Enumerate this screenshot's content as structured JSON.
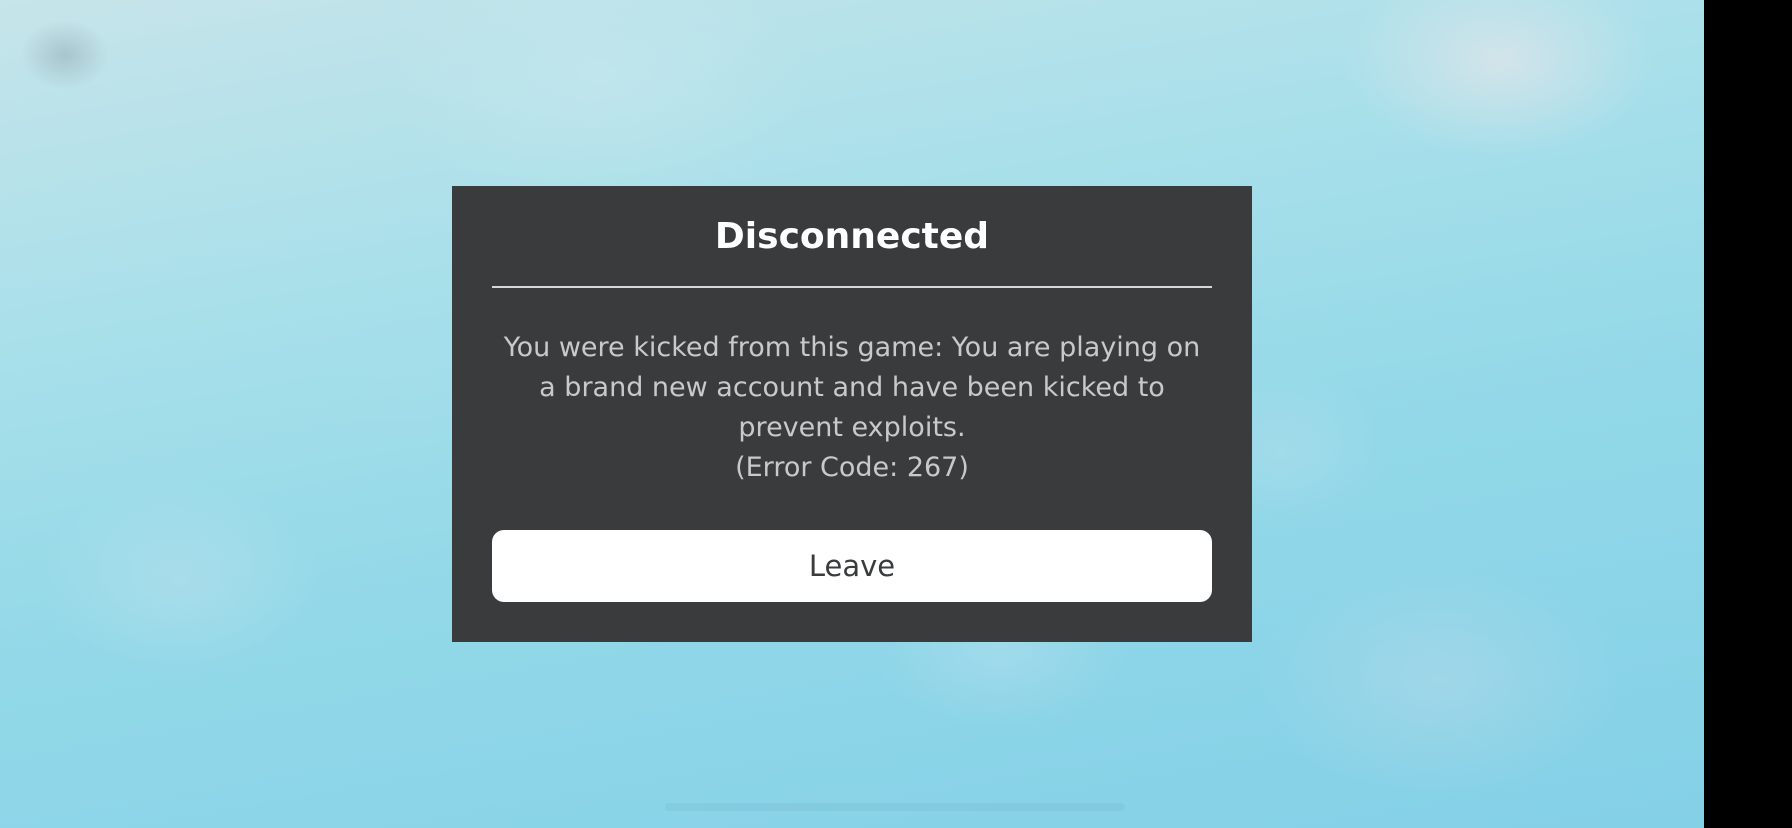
{
  "dialog": {
    "title": "Disconnected",
    "message": "You were kicked from this game: You are playing on a brand new account and have been kicked to prevent exploits.",
    "error_code": "(Error Code: 267)",
    "leave_label": "Leave"
  },
  "colors": {
    "dialog_background": "#393b3d",
    "title_text": "#ffffff",
    "message_text": "#c9c9c9",
    "button_background": "#ffffff",
    "button_text": "#393b3d",
    "sky": "#92d8e8"
  }
}
